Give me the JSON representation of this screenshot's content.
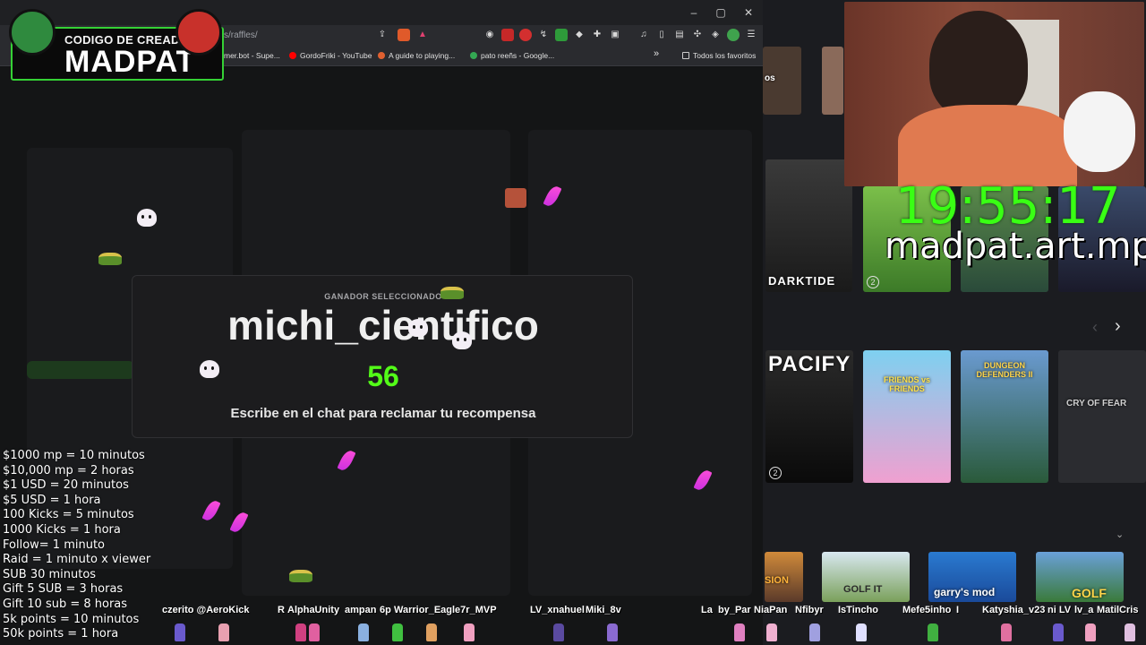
{
  "browser": {
    "url": "s/raffles/",
    "window_controls": [
      "–",
      "▢",
      "✕"
    ],
    "bookmarks": [
      "mer.bot - Supe...",
      "GordoFriki - YouTube",
      "A guide to playing...",
      "pato reeñs - Google...",
      "Todos los favoritos"
    ],
    "overflow_chevron": "»"
  },
  "creator_code": {
    "top_line": "CODIGO DE CREADOR",
    "name": "MADPAT"
  },
  "raffle_modal": {
    "label": "GANADOR SELECCIONADO",
    "winner": "michi_cientifico",
    "number": "56",
    "instruction": "Escribe en el chat para reclamar tu recompensa"
  },
  "price_list": [
    "$1000 mp = 10 minutos",
    "$10,000 mp = 2 horas",
    "$1 USD = 20 minutos",
    "$5 USD = 1 hora",
    "100 Kicks = 5 minutos",
    "1000 Kicks = 1 hora",
    "Follow= 1 minuto",
    "Raid = 1 minuto x viewer",
    "SUB 30 minutos",
    "Gift 5 SUB = 3 horas",
    "Gift 10 sub = 8 horas",
    "5k points = 10 minutos",
    "50k points = 1 hora"
  ],
  "stream_overlay": {
    "clock": "19:55:17",
    "handle": "madpat.art.mp"
  },
  "games": {
    "row1_caption": "DARKTIDE",
    "row1_partial": "os",
    "row2_captions": [
      "PACIFY",
      "FRIENDS vs FRIENDS",
      "DUNGEON DEFENDERS II",
      "CRY OF FEAR"
    ],
    "row3_captions": [
      "SION",
      "GOLF IT",
      "garry's mod",
      "GOLF"
    ],
    "badge_count": "2",
    "nav_prev": "‹",
    "nav_next": "›",
    "scroll_down": "⌄"
  },
  "chat_ticker": [
    "czerito @AeroKick",
    "R",
    "AlphaUnity",
    "ampan",
    "6p",
    "Warrior_Eagle7r_MVP",
    "LV_xnahuel",
    "Miki_8v",
    "La",
    "by_Par",
    "NiaPan",
    "Nfibyr",
    "IsTincho",
    "Mefe5inho",
    "I",
    "Katyshia_v23",
    "ni LV",
    "lv_a",
    "MatilCris"
  ],
  "colors": {
    "kick_green": "#53fc18",
    "clock_green": "#39ff14",
    "creator_border": "#35d135"
  }
}
